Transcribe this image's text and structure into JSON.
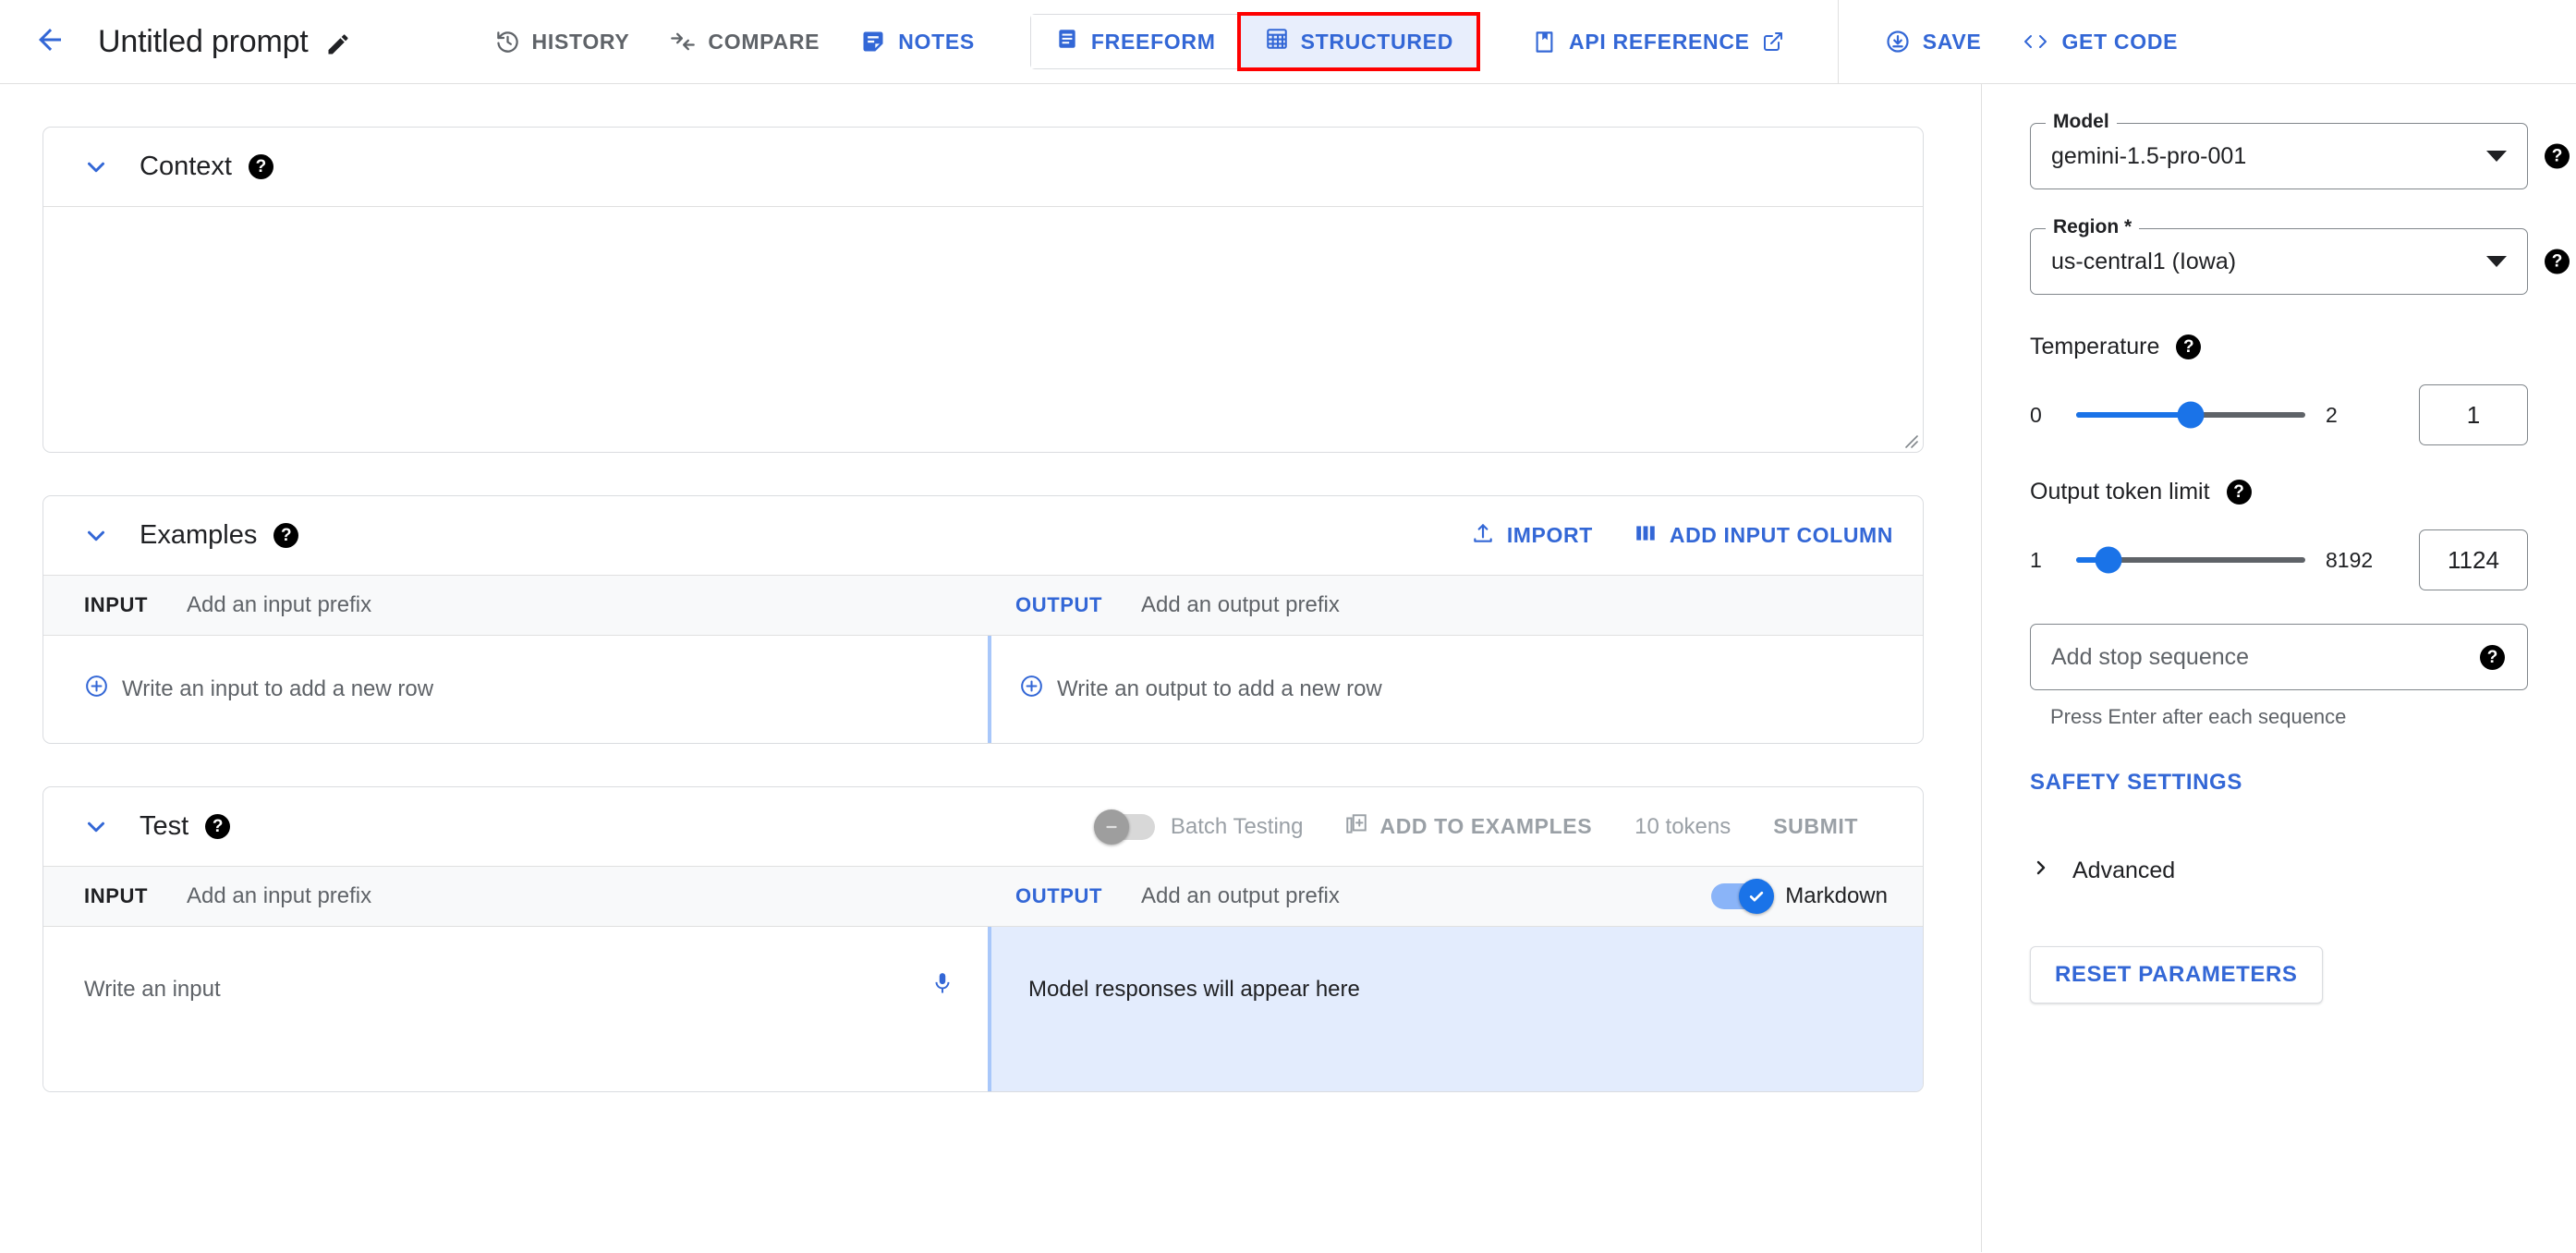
{
  "header": {
    "back_icon": "arrow-left-icon",
    "title": "Untitled prompt",
    "edit_icon": "pencil-edit-icon",
    "actions": [
      {
        "label": "HISTORY",
        "icon": "history-clock-icon",
        "state": "inactive"
      },
      {
        "label": "COMPARE",
        "icon": "compare-arrows-icon",
        "state": "inactive"
      },
      {
        "label": "NOTES",
        "icon": "notes-document-icon",
        "state": "active"
      }
    ],
    "mode_toggle": [
      {
        "label": "FREEFORM",
        "icon": "freeform-lines-icon",
        "selected": false
      },
      {
        "label": "STRUCTURED",
        "icon": "structured-grid-icon",
        "selected": true,
        "highlighted": true
      }
    ],
    "api_reference": {
      "label": "API REFERENCE",
      "icon": "book-bookmark-icon",
      "external_icon": "open-in-new-icon"
    },
    "save": {
      "label": "SAVE",
      "icon": "save-download-circle-icon"
    },
    "get_code": {
      "label": "GET CODE",
      "icon": "code-brackets-icon"
    }
  },
  "context": {
    "title": "Context",
    "help_icon": "help-circle-icon",
    "collapse_icon": "chevron-down-icon",
    "textarea_value": "",
    "resize_icon": "resize-grip-icon"
  },
  "examples": {
    "title": "Examples",
    "help_icon": "help-circle-icon",
    "collapse_icon": "chevron-down-icon",
    "import": {
      "label": "IMPORT",
      "icon": "upload-icon"
    },
    "add_input_column": {
      "label": "ADD INPUT COLUMN",
      "icon": "columns-icon"
    },
    "input_col_tag": "INPUT",
    "input_prefix_placeholder": "Add an input prefix",
    "output_col_tag": "OUTPUT",
    "output_prefix_placeholder": "Add an output prefix",
    "add_input_row": {
      "label": "Write an input to add a new row",
      "icon": "plus-circle-icon"
    },
    "add_output_row": {
      "label": "Write an output to add a new row",
      "icon": "plus-circle-icon"
    }
  },
  "test": {
    "title": "Test",
    "help_icon": "help-circle-icon",
    "collapse_icon": "chevron-down-icon",
    "batch_testing": {
      "label": "Batch Testing",
      "enabled": false
    },
    "add_to_examples": {
      "label": "ADD TO EXAMPLES",
      "icon": "add-to-examples-icon",
      "enabled": false
    },
    "token_count": "10 tokens",
    "submit": {
      "label": "SUBMIT",
      "enabled": false
    },
    "input_col_tag": "INPUT",
    "input_prefix_placeholder": "Add an input prefix",
    "output_col_tag": "OUTPUT",
    "output_prefix_placeholder": "Add an output prefix",
    "markdown": {
      "label": "Markdown",
      "enabled": true
    },
    "input_placeholder": "Write an input",
    "mic_icon": "microphone-icon",
    "output_placeholder": "Model responses will appear here"
  },
  "parameters": {
    "model": {
      "label": "Model",
      "value": "gemini-1.5-pro-001",
      "help_icon": "help-circle-icon",
      "caret_icon": "chevron-down-icon"
    },
    "region": {
      "label": "Region *",
      "value": "us-central1 (Iowa)",
      "help_icon": "help-circle-icon",
      "caret_icon": "chevron-down-icon"
    },
    "temperature": {
      "label": "Temperature",
      "min": "0",
      "max": "2",
      "value": "1",
      "fill_percent": 50,
      "help_icon": "help-circle-icon"
    },
    "output_token_limit": {
      "label": "Output token limit",
      "min": "1",
      "max": "8192",
      "value": "1124",
      "fill_percent": 14,
      "help_icon": "help-circle-icon"
    },
    "stop_sequence": {
      "placeholder": "Add stop sequence",
      "hint": "Press Enter after each sequence",
      "help_icon": "help-circle-icon"
    },
    "safety_settings": {
      "label": "SAFETY SETTINGS"
    },
    "advanced": {
      "label": "Advanced",
      "icon": "chevron-right-icon"
    },
    "reset": {
      "label": "RESET PARAMETERS"
    }
  },
  "colors": {
    "accent_blue": "#3367d6",
    "slider_blue": "#1a73e8",
    "highlight_red": "#fe0000",
    "output_bg": "#e3ecfd",
    "active_seg_bg": "#e8eefc"
  }
}
